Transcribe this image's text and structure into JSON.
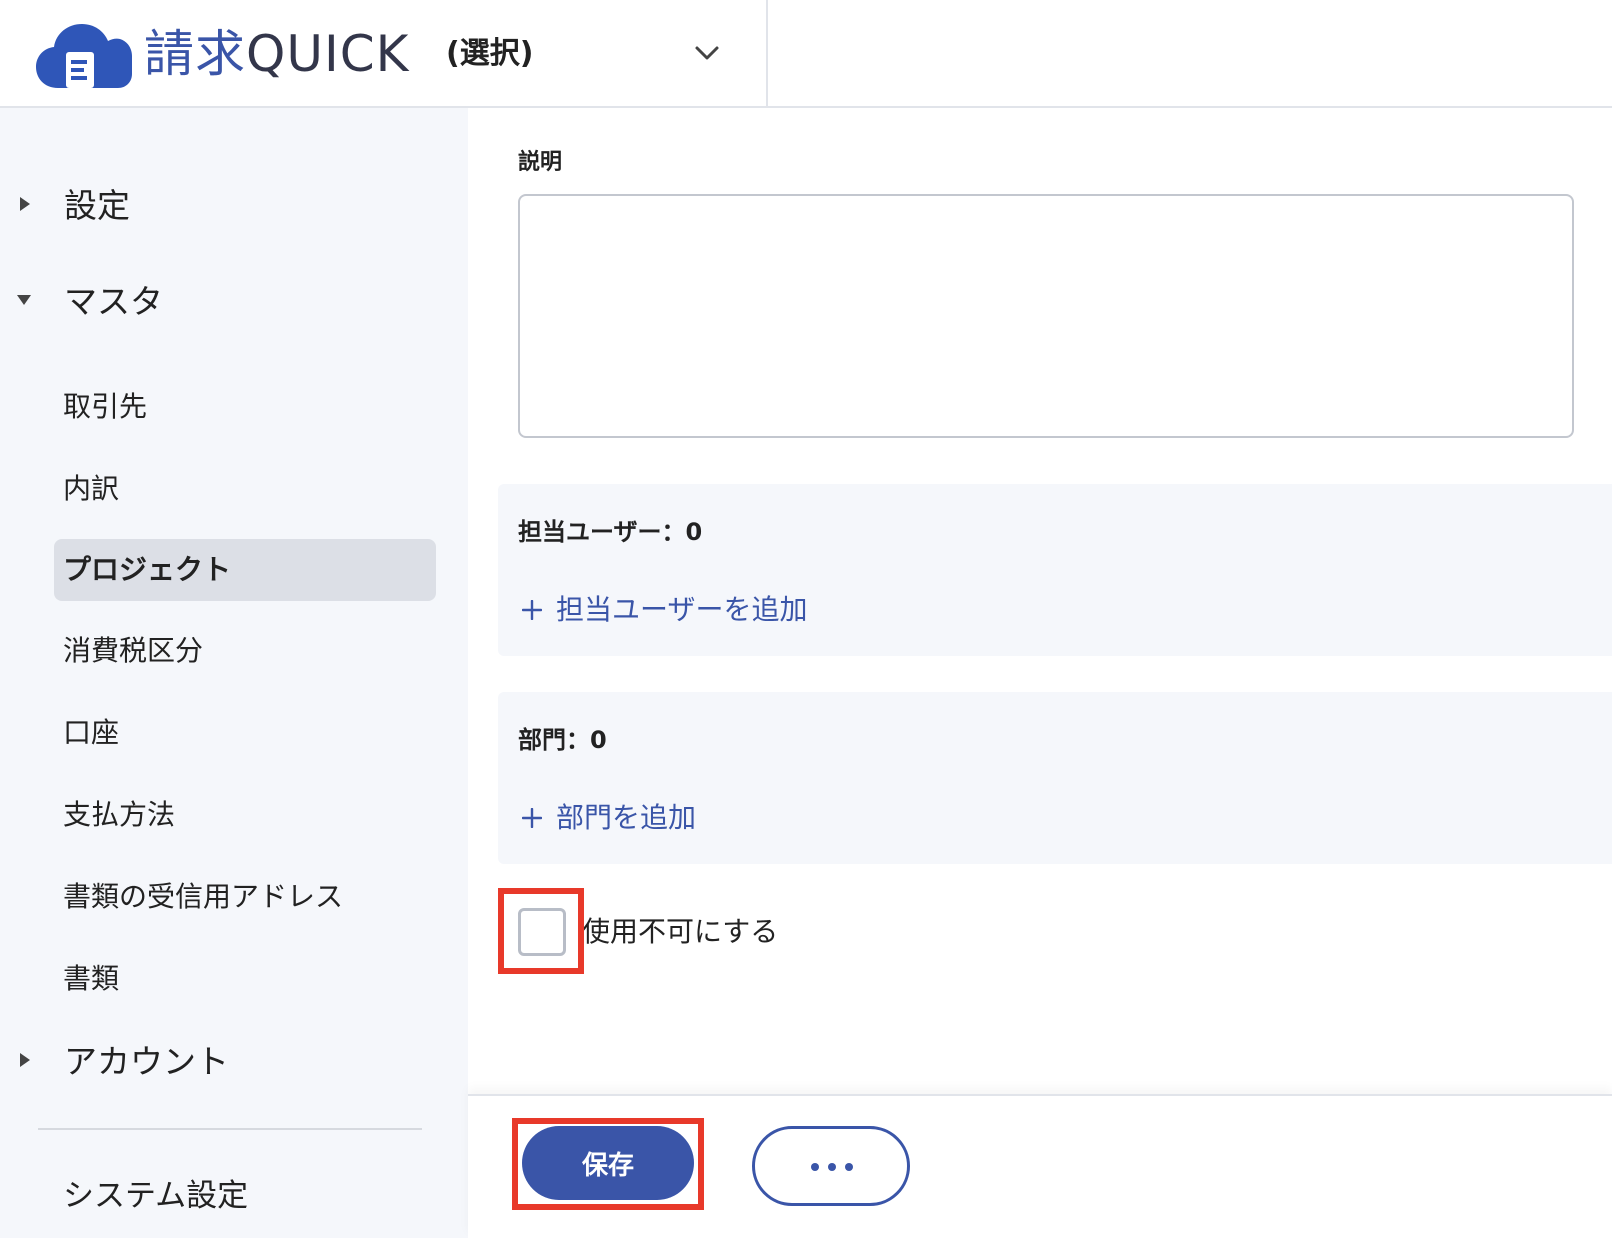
{
  "brand": {
    "name_part1": "請求",
    "name_part2": "QUICK",
    "logo_icon": "cloud-document-icon",
    "primary_color": "#3a55a8"
  },
  "header": {
    "selector_value": "(選択)",
    "selector_icon": "chevron-down-icon"
  },
  "sidebar": {
    "groups": [
      {
        "label": "設定",
        "expanded": false
      },
      {
        "label": "マスタ",
        "expanded": true
      },
      {
        "label": "アカウント",
        "expanded": false
      }
    ],
    "master_items": [
      {
        "label": "取引先",
        "active": false
      },
      {
        "label": "内訳",
        "active": false
      },
      {
        "label": "プロジェクト",
        "active": true
      },
      {
        "label": "消費税区分",
        "active": false
      },
      {
        "label": "口座",
        "active": false
      },
      {
        "label": "支払方法",
        "active": false
      },
      {
        "label": "書類の受信用アドレス",
        "active": false
      },
      {
        "label": "書類",
        "active": false
      }
    ],
    "system_settings": "システム設定"
  },
  "form": {
    "description_label": "説明",
    "description_value": "",
    "users_panel": {
      "title": "担当ユーザー：0",
      "add_link": "担当ユーザーを追加"
    },
    "departments_panel": {
      "title": "部門：0",
      "add_link": "部門を追加"
    },
    "disable_checkbox": {
      "label": "使用不可にする",
      "checked": false
    }
  },
  "footer": {
    "save_label": "保存",
    "more_icon": "more-horizontal-icon"
  },
  "highlight_color": "#e8392a"
}
